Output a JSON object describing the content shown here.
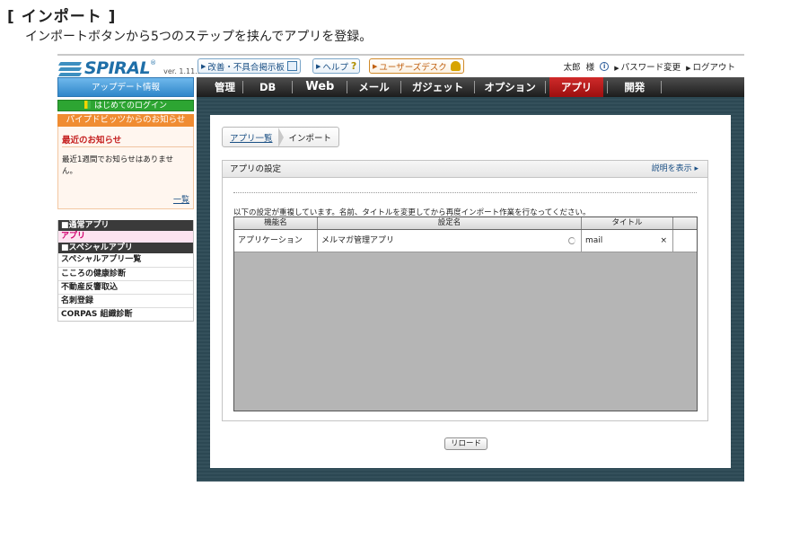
{
  "doc": {
    "title": "[ インポート ]",
    "subtitle": "インポートボタンから5つのステップを挟んでアプリを登録。"
  },
  "header": {
    "logo_text": "SPIRAL",
    "logo_reg": "®",
    "version": "ver. 1.11.3",
    "board_label": "改善・不具合掲示板",
    "help_label": "ヘルプ",
    "help_icon_text": "?",
    "desk_label": "ユーザーズデスク",
    "user_name": "太郎",
    "user_suffix": "様",
    "info_icon_text": "i",
    "password_label": "パスワード変更",
    "logout_label": "ログアウト"
  },
  "nav": {
    "items": [
      "管理",
      "DB",
      "Web",
      "メール",
      "ガジェット",
      "オプション",
      "アプリ",
      "開発"
    ],
    "active": "アプリ"
  },
  "sidebar": {
    "update_label": "アップデート情報",
    "first_login_label": "はじめてのログイン",
    "news_header": "パイプドビッツからのお知らせ",
    "news_title": "最近のお知らせ",
    "news_text": "最近1週間でお知らせはありません。",
    "news_more": "一覧",
    "sections": [
      {
        "title": "■通常アプリ",
        "items": [
          "アプリ"
        ]
      },
      {
        "title": "■スペシャルアプリ",
        "items": [
          "スペシャルアプリ一覧",
          "こころの健康診断",
          "不動産反響取込",
          "名刺登録",
          "CORPAS 組織診断"
        ]
      }
    ]
  },
  "main": {
    "breadcrumb_link": "アプリ一覧",
    "breadcrumb_current": "インポート",
    "panel_title": "アプリの設定",
    "panel_help": "説明を表示 ▸",
    "message": "以下の設定が重複しています。名前、タイトルを変更してから再度インポート作業を行なってください。",
    "columns": [
      "機能名",
      "設定名",
      "タイトル"
    ],
    "rows": [
      {
        "function": "アプリケーション",
        "setting": "メルマガ管理アプリ",
        "title": "mail",
        "clear": "×"
      }
    ],
    "reload_label": "リロード"
  },
  "colors": {
    "nav_active": "#b81818",
    "link": "#1a4f84",
    "news_header": "#f08c32",
    "login_green": "#2da532",
    "update_blue": "#3f94d4",
    "main_bg": "#2d4a56"
  }
}
